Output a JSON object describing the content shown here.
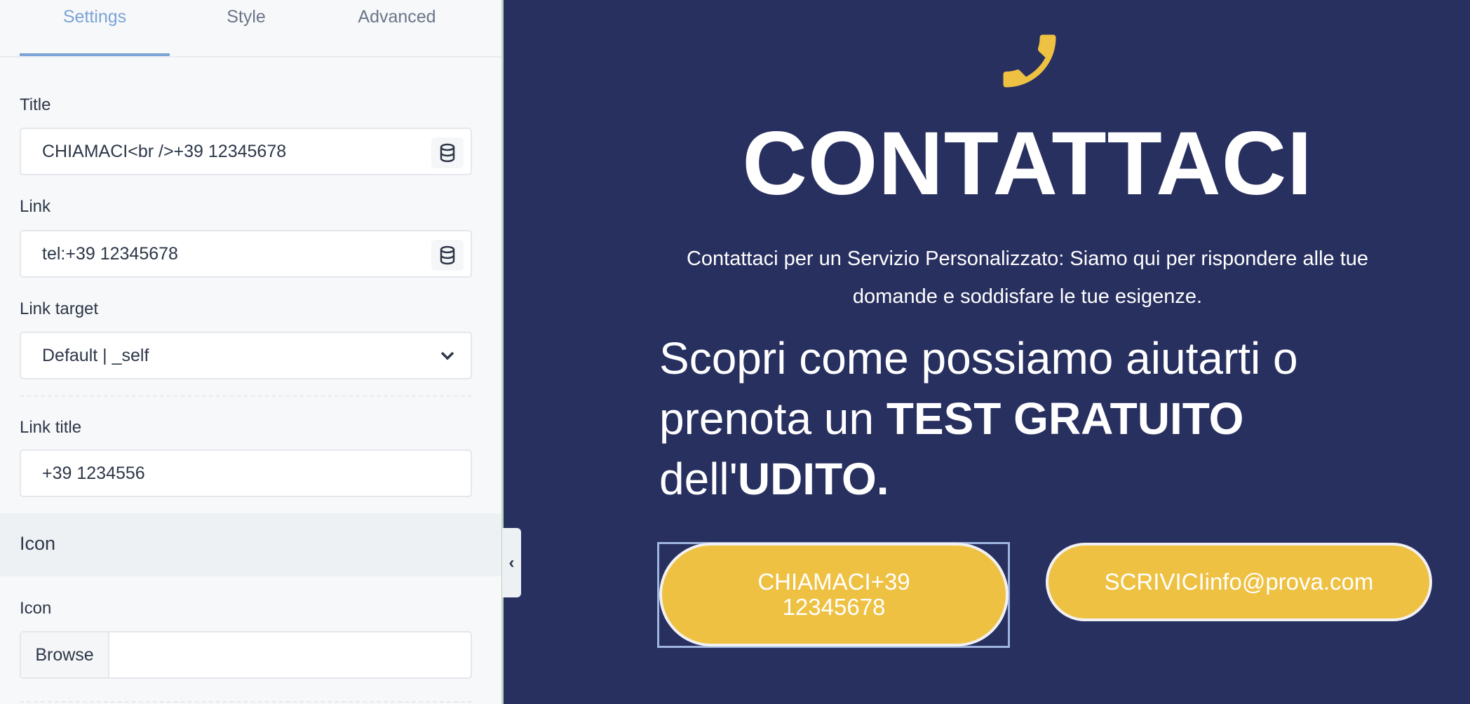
{
  "sidebar": {
    "tabs": [
      {
        "label": "Settings",
        "active": true
      },
      {
        "label": "Style"
      },
      {
        "label": "Advanced"
      }
    ],
    "fields": {
      "title": {
        "label": "Title",
        "value": "CHIAMACI<br />+39 12345678",
        "icon": "database-icon"
      },
      "link": {
        "label": "Link",
        "value": "tel:+39 12345678",
        "icon": "database-icon"
      },
      "link_target": {
        "label": "Link target",
        "value": "Default | _self"
      },
      "link_title": {
        "label": "Link title",
        "value": "+39 1234556"
      }
    },
    "icon_section": {
      "heading": "Icon",
      "field_label": "Icon",
      "browse_label": "Browse",
      "value": ""
    }
  },
  "preview": {
    "icon": "phone-icon",
    "title": "CONTATTACI",
    "description": "Contattaci per un Servizio Personalizzato: Siamo qui per rispondere alle tue domande e soddisfare le tue esigenze.",
    "heading": {
      "part1": "Scopri come possiamo aiutarti o prenota un ",
      "bold1": "TEST GRATUITO",
      "part2": " dell'",
      "bold2": "UDITO."
    },
    "buttons": [
      {
        "line1": "CHIAMACI+39",
        "line2": "12345678"
      },
      {
        "label": "SCRIVICIinfo@prova.com"
      }
    ]
  },
  "colors": {
    "background": "#283060",
    "accent": "#eec142",
    "tab_active": "#7ba3d6"
  }
}
